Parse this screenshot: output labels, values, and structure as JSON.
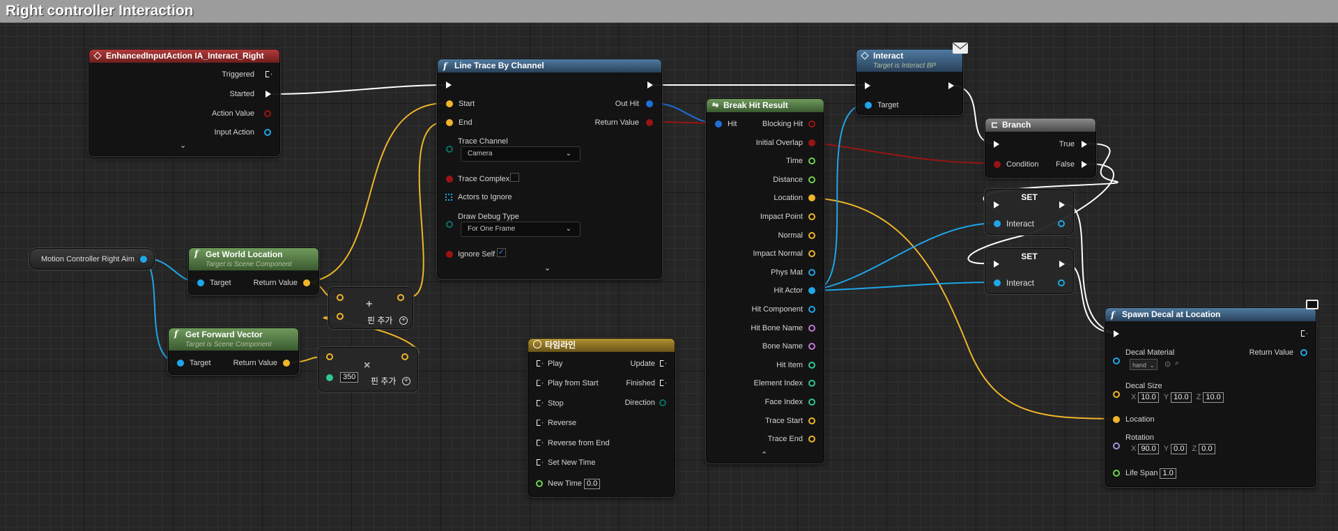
{
  "graph": {
    "title": "Right controller Interaction"
  },
  "nodes": {
    "input_action": {
      "title": "EnhancedInputAction IA_Interact_Right",
      "pins": {
        "triggered": "Triggered",
        "started": "Started",
        "action_value": "Action Value",
        "input_action": "Input Action"
      },
      "collapse": "⌄"
    },
    "line_trace": {
      "title": "Line Trace By Channel",
      "pins": {
        "start": "Start",
        "end": "End",
        "out_hit": "Out Hit",
        "return_value": "Return Value",
        "trace_channel": "Trace Channel",
        "trace_complex": "Trace Complex",
        "actors_to_ignore": "Actors to Ignore",
        "draw_debug_type": "Draw Debug Type",
        "ignore_self": "Ignore Self"
      },
      "trace_channel_value": "Camera",
      "draw_debug_value": "For One Frame",
      "ignore_self_check": "✓",
      "collapse": "⌄"
    },
    "interact": {
      "title": "Interact",
      "subtitle": "Target is Interact BP",
      "pins": {
        "target": "Target"
      },
      "icon": "envelope-icon"
    },
    "break_hit": {
      "title": "Break Hit Result",
      "pins": {
        "hit": "Hit",
        "blocking_hit": "Blocking Hit",
        "initial_overlap": "Initial Overlap",
        "time": "Time",
        "distance": "Distance",
        "location": "Location",
        "impact_point": "Impact Point",
        "normal": "Normal",
        "impact_normal": "Impact Normal",
        "phys_mat": "Phys Mat",
        "hit_actor": "Hit Actor",
        "hit_component": "Hit Component",
        "hit_bone_name": "Hit Bone Name",
        "bone_name": "Bone Name",
        "hit_item": "Hit Item",
        "element_index": "Element Index",
        "face_index": "Face Index",
        "trace_start": "Trace Start",
        "trace_end": "Trace End"
      },
      "collapse": "⌃"
    },
    "branch": {
      "title": "Branch",
      "pins": {
        "true": "True",
        "false": "False",
        "condition": "Condition"
      }
    },
    "set1": {
      "title": "SET",
      "pins": {
        "interact": "Interact"
      }
    },
    "set2": {
      "title": "SET",
      "pins": {
        "interact": "Interact"
      }
    },
    "motion_controller": {
      "label": "Motion Controller Right Aim"
    },
    "get_world_location": {
      "title": "Get World Location",
      "subtitle": "Target is Scene Component",
      "pins": {
        "target": "Target",
        "return_value": "Return Value"
      }
    },
    "get_forward_vector": {
      "title": "Get Forward Vector",
      "subtitle": "Target is Scene Component",
      "pins": {
        "target": "Target",
        "return_value": "Return Value"
      }
    },
    "add_node": {
      "symbol": "+",
      "add_pin": "핀 추가"
    },
    "multiply_node": {
      "symbol": "×",
      "value": "350",
      "add_pin": "핀 추가"
    },
    "timeline": {
      "title": "타임라인",
      "pins": {
        "play": "Play",
        "play_from_start": "Play from Start",
        "stop": "Stop",
        "reverse": "Reverse",
        "reverse_from_end": "Reverse from End",
        "set_new_time": "Set New Time",
        "new_time": "New Time",
        "update": "Update",
        "finished": "Finished",
        "direction": "Direction"
      },
      "new_time_value": "0.0"
    },
    "spawn_decal": {
      "title": "Spawn Decal at Location",
      "pins": {
        "decal_material": "Decal Material",
        "return_value": "Return Value",
        "decal_size": "Decal Size",
        "location": "Location",
        "rotation": "Rotation",
        "life_span": "Life Span"
      },
      "material_value": "hand",
      "size": {
        "x": "10.0",
        "y": "10.0",
        "z": "10.0"
      },
      "rotation": {
        "x": "90.0",
        "y": "0.0",
        "z": "0.0"
      },
      "axis": {
        "x": "X",
        "y": "Y",
        "z": "Z"
      },
      "life_span_value": "1.0",
      "icon": "monitor-icon"
    }
  },
  "colors": {
    "exec": "#ffffff",
    "struct": "#1f6fd8",
    "bool": "#9b1414",
    "float": "#6ed34a",
    "vector": "#f0b52a",
    "object": "#1fa6e8",
    "name": "#c07ad8",
    "int": "#2ec79a",
    "enum": "#0b6e66"
  }
}
